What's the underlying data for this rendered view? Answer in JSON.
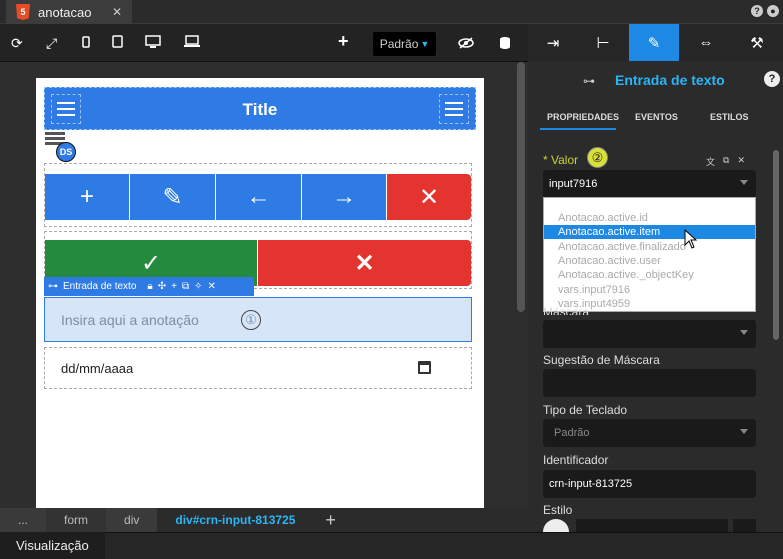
{
  "tab": {
    "label": "anotacao",
    "close": "✕",
    "html5_badge": "5"
  },
  "topright": {
    "help": "?",
    "settings": "●"
  },
  "toolbar": {
    "refresh_icon": "⟳",
    "expand_icon": "⤢",
    "add": "+",
    "viewport": "Padrão",
    "visibility_icon": "eye-off-icon",
    "db_icon": "database-icon"
  },
  "canvas": {
    "app_title": "Title",
    "ds_label": "DS",
    "element_bar_label": "Entrada de texto",
    "input_placeholder": "Insira aqui a anotação",
    "marker1": "①",
    "date_placeholder": "dd/mm/aaaa",
    "buttons_row1": [
      "+",
      "✎",
      "←",
      "→",
      "✕"
    ],
    "buttons_row2": [
      "✓",
      "✕"
    ]
  },
  "breadcrumbs": [
    "...",
    "form",
    "div",
    "div#crn-input-813725"
  ],
  "breadcrumb_add": "+",
  "bottom": {
    "label": "Visualização"
  },
  "panel": {
    "title": "Entrada de texto",
    "help": "?",
    "subtabs": [
      "PROPRIEDADES",
      "EVENTOS",
      "ESTILOS"
    ],
    "valor_label": "* Valor",
    "marker2": "②",
    "valor_value": "input7916",
    "dropdown_options": [
      "Anotacao.active.id",
      "Anotacao.active.item",
      "Anotacao.active.finalizado",
      "Anotacao.active.user",
      "Anotacao.active._objectKey",
      "vars.input7916",
      "vars.input4959"
    ],
    "dropdown_selected_index": 1,
    "mascara_label": "Máscara",
    "sugestao_label": "Sugestão de Máscara",
    "teclado_label": "Tipo de Teclado",
    "teclado_value": "Padrão",
    "identificador_label": "Identificador",
    "identificador_value": "crn-input-813725",
    "estilo_label": "Estilo"
  },
  "colors": {
    "accent": "#1e88e5",
    "brand_blue": "#2f7be6",
    "danger": "#e3342f",
    "success": "#238a3e",
    "valor_label": "#c7d33a"
  }
}
